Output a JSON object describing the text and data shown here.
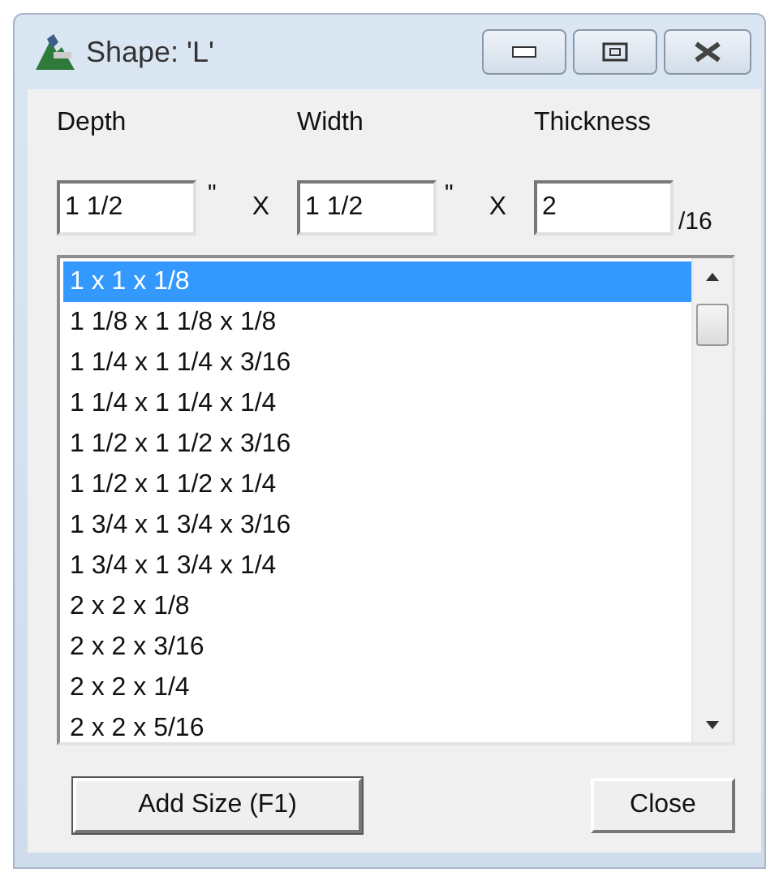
{
  "window": {
    "title": "Shape: 'L'"
  },
  "inputs": [
    {
      "label": "Depth",
      "value": "1 1/2",
      "unit": "\""
    },
    {
      "label": "Width",
      "value": "1 1/2",
      "unit": "\""
    },
    {
      "label": "Thickness",
      "value": "2",
      "unit": "/16"
    }
  ],
  "separators": [
    "X",
    "X"
  ],
  "sizes": [
    {
      "label": "1 x 1 x 1/8",
      "selected": true
    },
    {
      "label": "1 1/8 x 1 1/8 x 1/8",
      "selected": false
    },
    {
      "label": "1 1/4 x 1 1/4 x 3/16",
      "selected": false
    },
    {
      "label": "1 1/4 x 1 1/4 x 1/4",
      "selected": false
    },
    {
      "label": "1 1/2 x 1 1/2 x 3/16",
      "selected": false
    },
    {
      "label": "1 1/2 x 1 1/2 x 1/4",
      "selected": false
    },
    {
      "label": "1 3/4 x 1 3/4 x 3/16",
      "selected": false
    },
    {
      "label": "1 3/4 x 1 3/4 x 1/4",
      "selected": false
    },
    {
      "label": "2 x 2 x 1/8",
      "selected": false
    },
    {
      "label": "2 x 2 x 3/16",
      "selected": false
    },
    {
      "label": "2 x 2 x 1/4",
      "selected": false
    },
    {
      "label": "2 x 2 x 5/16",
      "selected": false
    }
  ],
  "buttons": [
    {
      "label": "Add Size (F1)",
      "kind": "default"
    },
    {
      "label": "Close",
      "kind": "normal"
    }
  ]
}
